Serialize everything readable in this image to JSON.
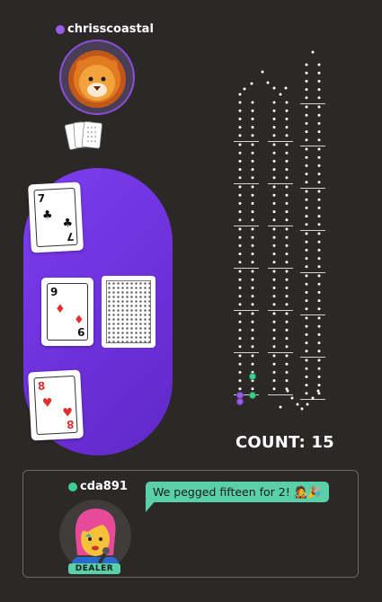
{
  "opponent": {
    "name": "chrisscoastal",
    "status_color": "#9b5de5",
    "avatar": "lion-emoji"
  },
  "table_cards": [
    {
      "rank": "7",
      "suit": "clubs",
      "color": "black"
    },
    {
      "rank": "9",
      "suit": "diamonds",
      "color": "red"
    },
    {
      "rank": "8",
      "suit": "hearts",
      "color": "red"
    }
  ],
  "count": {
    "label": "COUNT: 15"
  },
  "player": {
    "name": "cda891",
    "status_color": "#3ecf8e",
    "avatar": "singer-emoji",
    "dealer_badge": "DEALER"
  },
  "chat": {
    "message": "We pegged fifteen for 2! 🧑‍🎤🎉"
  },
  "colors": {
    "table": "#7d3ef0",
    "accent_green": "#5ad0a8",
    "peg_purple": "#9b5de5",
    "peg_green": "#3ecf8e"
  }
}
